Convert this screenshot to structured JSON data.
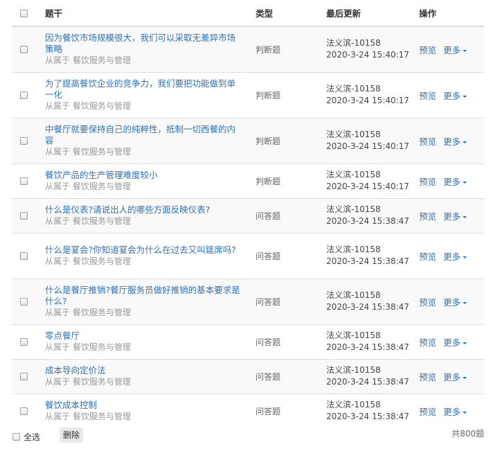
{
  "header": {
    "title": "题干",
    "type": "类型",
    "updated": "最后更新",
    "ops": "操作"
  },
  "rows": [
    {
      "title": "因为餐饮市场规模很大，我们可以采取无差异市场策略",
      "belongs": "从属于 餐饮服务与管理",
      "type": "判断题",
      "user": "法义滨-10158",
      "time": "2020-3-24 15:40:17",
      "preview": "预览",
      "more": "更多"
    },
    {
      "title": "为了提高餐饮企业的竞争力，我们要把功能做到单一化",
      "belongs": "从属于 餐饮服务与管理",
      "type": "判断题",
      "user": "法义滨-10158",
      "time": "2020-3-24 15:40:17",
      "preview": "预览",
      "more": "更多"
    },
    {
      "title": "中餐厅就要保持自己的纯粹性，抵制一切西餐的内容",
      "belongs": "从属于 餐饮服务与管理",
      "type": "判断题",
      "user": "法义滨-10158",
      "time": "2020-3-24 15:40:17",
      "preview": "预览",
      "more": "更多"
    },
    {
      "title": "餐饮产品的生产管理难度较小",
      "belongs": "从属于 餐饮服务与管理",
      "type": "判断题",
      "user": "法义滨-10158",
      "time": "2020-3-24 15:40:17",
      "preview": "预览",
      "more": "更多"
    },
    {
      "title": "什么是仪表?请说出人的哪些方面反映仪表?",
      "belongs": "从属于 餐饮服务与管理",
      "type": "问答题",
      "user": "法义滨-10158",
      "time": "2020-3-24 15:38:47",
      "preview": "预览",
      "more": "更多"
    },
    {
      "title": "什么是宴会?你知道宴会为什么在过去又叫筵席吗?",
      "belongs": "从属于 餐饮服务与管理",
      "type": "问答题",
      "user": "法义滨-10158",
      "time": "2020-3-24 15:38:47",
      "preview": "预览",
      "more": "更多"
    },
    {
      "title": "什么是餐厅推销?餐厅服务员做好推销的基本要求是什么?",
      "belongs": "从属于 餐饮服务与管理",
      "type": "问答题",
      "user": "法义滨-10158",
      "time": "2020-3-24 15:38:47",
      "preview": "预览",
      "more": "更多"
    },
    {
      "title": "零点餐厅",
      "belongs": "从属于 餐饮服务与管理",
      "type": "问答题",
      "user": "法义滨-10158",
      "time": "2020-3-24 15:38:47",
      "preview": "预览",
      "more": "更多"
    },
    {
      "title": "成本导向定价法",
      "belongs": "从属于 餐饮服务与管理",
      "type": "问答题",
      "user": "法义滨-10158",
      "time": "2020-3-24 15:38:47",
      "preview": "预览",
      "more": "更多"
    },
    {
      "title": "餐饮成本控制",
      "belongs": "从属于 餐饮服务与管理",
      "type": "问答题",
      "user": "法义滨-10158",
      "time": "2020-3-24 15:38:47",
      "preview": "预览",
      "more": "更多"
    }
  ],
  "footer": {
    "select_all": "全选",
    "delete": "删除",
    "total": "共800题"
  }
}
